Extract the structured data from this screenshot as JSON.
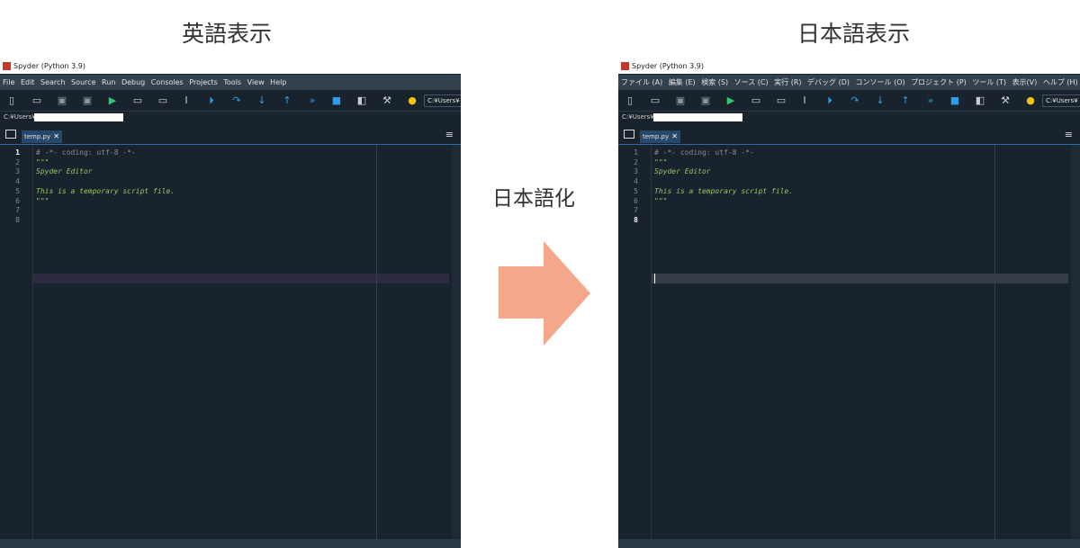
{
  "left": {
    "heading": "英語表示",
    "title": "Spyder (Python 3.9)",
    "menu": [
      "File",
      "Edit",
      "Search",
      "Source",
      "Run",
      "Debug",
      "Consoles",
      "Projects",
      "Tools",
      "View",
      "Help"
    ],
    "toolbar_path": "C:¥Users¥",
    "path_row": "C:¥Users¥",
    "tab_label": "temp.py",
    "tab_close": "✕",
    "current_line": "1"
  },
  "right": {
    "heading": "日本語表示",
    "title": "Spyder (Python 3.9)",
    "menu": [
      "ファイル (A)",
      "編集 (E)",
      "検索 (S)",
      "ソース (C)",
      "実行 (R)",
      "デバッグ (D)",
      "コンソール (O)",
      "プロジェクト (P)",
      "ツール (T)",
      "表示(V)",
      "ヘルプ (H)"
    ],
    "toolbar_path": "C:¥Users¥",
    "path_row": "C:¥Users¥",
    "tab_label": "temp.py",
    "tab_close": "✕",
    "current_line": "8"
  },
  "code": {
    "line_numbers": [
      "1",
      "2",
      "3",
      "4",
      "5",
      "6",
      "7",
      "8"
    ],
    "lines": [
      "# -*- coding: utf-8 -*-",
      "\"\"\"",
      "Spyder Editor",
      "",
      "This is a temporary script file.",
      "\"\"\"",
      "",
      ""
    ]
  },
  "middle": {
    "label": "日本語化",
    "arrow_color": "#f4a78a"
  },
  "colors": {
    "editor_bg": "#19232d",
    "menubar_bg": "#32414b",
    "docstring": "#95c560",
    "comment": "#8a8a8a",
    "tab_bg": "#26486b"
  }
}
